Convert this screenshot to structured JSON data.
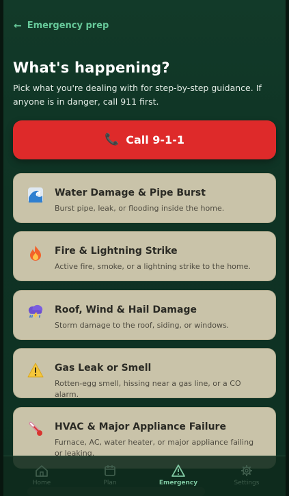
{
  "header": {
    "back_label": "Emergency prep"
  },
  "page": {
    "title": "What's happening?",
    "subtitle": "Pick what you're dealing with for step-by-step guidance. If anyone is in danger, call 911 first."
  },
  "call_button": {
    "label": "Call 9-1-1",
    "icon": "phone-icon"
  },
  "colors": {
    "background": "#0f3324",
    "accent": "#67c99a",
    "call_button": "#de2a2a",
    "card": "#c9c3a9"
  },
  "emergencies": [
    {
      "icon": "water-wave-icon",
      "title": "Water Damage & Pipe Burst",
      "description": "Burst pipe, leak, or flooding inside the home."
    },
    {
      "icon": "fire-icon",
      "title": "Fire & Lightning Strike",
      "description": "Active fire, smoke, or a lightning strike to the home."
    },
    {
      "icon": "storm-cloud-icon",
      "title": "Roof, Wind & Hail Damage",
      "description": "Storm damage to the roof, siding, or windows."
    },
    {
      "icon": "warning-triangle-icon",
      "title": "Gas Leak or Smell",
      "description": "Rotten-egg smell, hissing near a gas line, or a CO alarm."
    },
    {
      "icon": "thermometer-icon",
      "title": "HVAC & Major Appliance Failure",
      "description": "Furnace, AC, water heater, or major appliance failing or leaking."
    }
  ],
  "nav": [
    {
      "label": "Home",
      "icon": "home-icon",
      "active": false
    },
    {
      "label": "Plan",
      "icon": "calendar-icon",
      "active": false
    },
    {
      "label": "Emergency",
      "icon": "warning-triangle-icon",
      "active": true
    },
    {
      "label": "Settings",
      "icon": "gear-icon",
      "active": false
    }
  ]
}
